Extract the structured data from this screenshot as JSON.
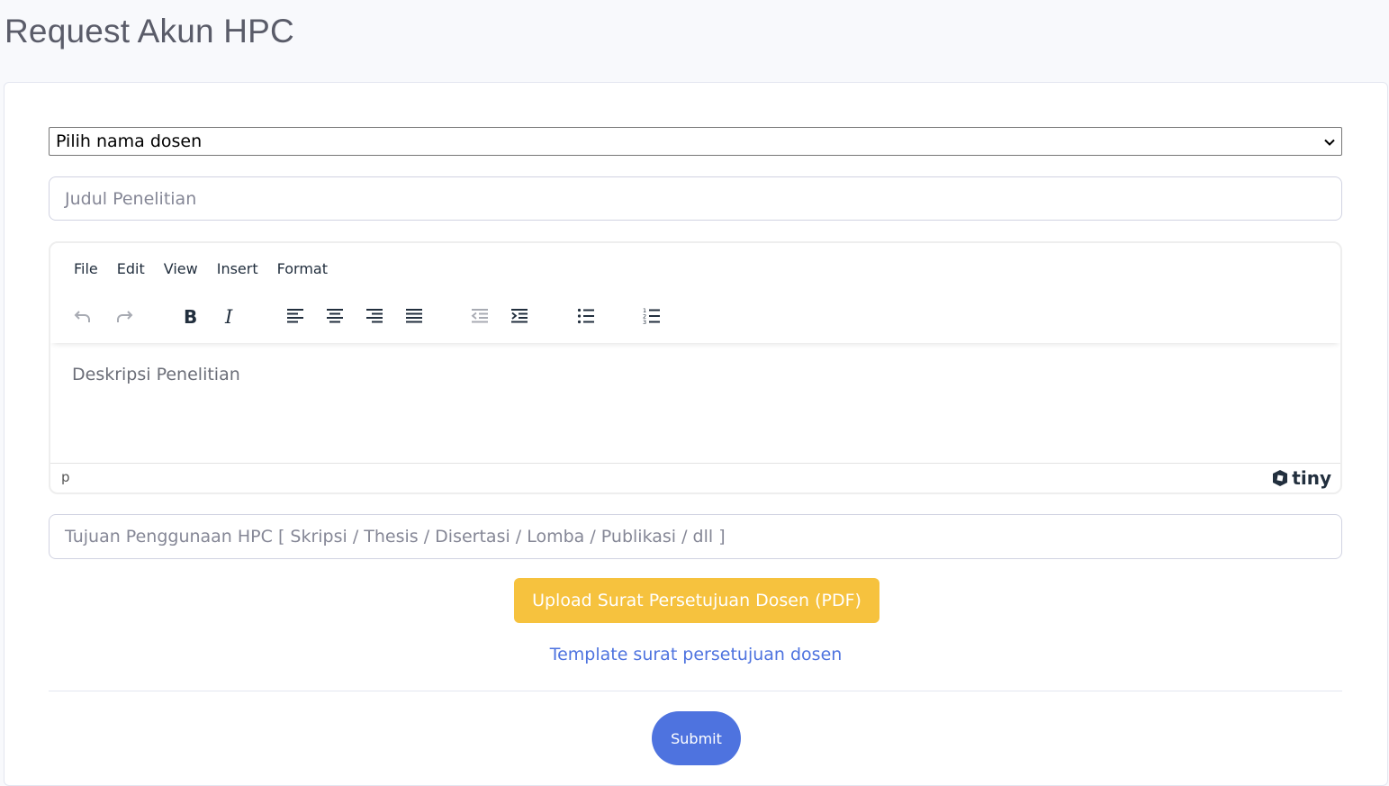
{
  "page": {
    "title": "Request Akun HPC"
  },
  "form": {
    "dosen_select": {
      "selected": "Pilih nama dosen"
    },
    "judul_input": {
      "placeholder": "Judul Penelitian"
    },
    "editor": {
      "menu": [
        "File",
        "Edit",
        "View",
        "Insert",
        "Format"
      ],
      "toolbar_icons": [
        "undo-icon",
        "redo-icon",
        "bold-icon",
        "italic-icon",
        "align-left-icon",
        "align-center-icon",
        "align-right-icon",
        "align-justify-icon",
        "outdent-icon",
        "indent-icon",
        "bullet-list-icon",
        "numbered-list-icon"
      ],
      "placeholder": "Deskripsi Penelitian",
      "status_path": "p",
      "brand": "tiny"
    },
    "tujuan_input": {
      "placeholder": "Tujuan Penggunaan HPC [ Skripsi / Thesis / Disertasi / Lomba / Publikasi / dll ]"
    },
    "upload_button": "Upload Surat Persetujuan Dosen (PDF)",
    "template_link": "Template surat persetujuan dosen",
    "submit_button": "Submit"
  },
  "colors": {
    "primary": "#4e73df",
    "warning": "#f6c23e",
    "text": "#5a5c69",
    "background": "#f8f9fc"
  }
}
